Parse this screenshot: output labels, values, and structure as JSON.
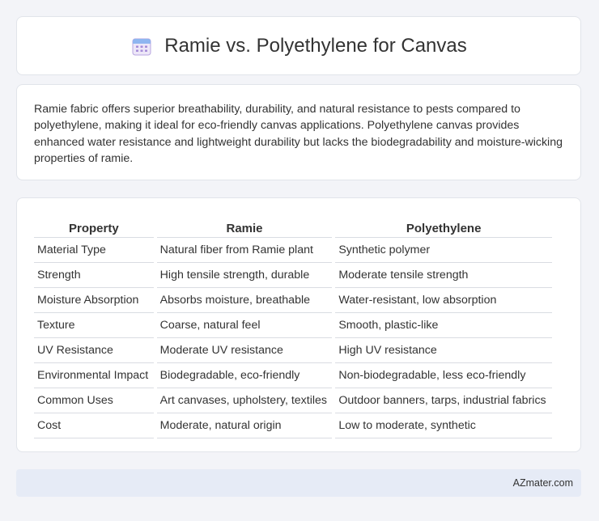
{
  "header": {
    "title": "Ramie vs. Polyethylene for Canvas",
    "icon": "calendar-icon",
    "icon_color": "#8e7cc3"
  },
  "intro": {
    "text": "Ramie fabric offers superior breathability, durability, and natural resistance to pests compared to polyethylene, making it ideal for eco-friendly canvas applications. Polyethylene canvas provides enhanced water resistance and lightweight durability but lacks the biodegradability and moisture-wicking properties of ramie."
  },
  "table": {
    "headers": [
      "Property",
      "Ramie",
      "Polyethylene"
    ],
    "rows": [
      [
        "Material Type",
        "Natural fiber from Ramie plant",
        "Synthetic polymer"
      ],
      [
        "Strength",
        "High tensile strength, durable",
        "Moderate tensile strength"
      ],
      [
        "Moisture Absorption",
        "Absorbs moisture, breathable",
        "Water-resistant, low absorption"
      ],
      [
        "Texture",
        "Coarse, natural feel",
        "Smooth, plastic-like"
      ],
      [
        "UV Resistance",
        "Moderate UV resistance",
        "High UV resistance"
      ],
      [
        "Environmental Impact",
        "Biodegradable, eco-friendly",
        "Non-biodegradable, less eco-friendly"
      ],
      [
        "Common Uses",
        "Art canvases, upholstery, textiles",
        "Outdoor banners, tarps, industrial fabrics"
      ],
      [
        "Cost",
        "Moderate, natural origin",
        "Low to moderate, synthetic"
      ]
    ]
  },
  "footer": {
    "site": "AZmater.com"
  },
  "colors": {
    "background": "#f3f4f8",
    "card": "#ffffff",
    "footer_bg": "#e6ebf6",
    "text": "#333333"
  }
}
